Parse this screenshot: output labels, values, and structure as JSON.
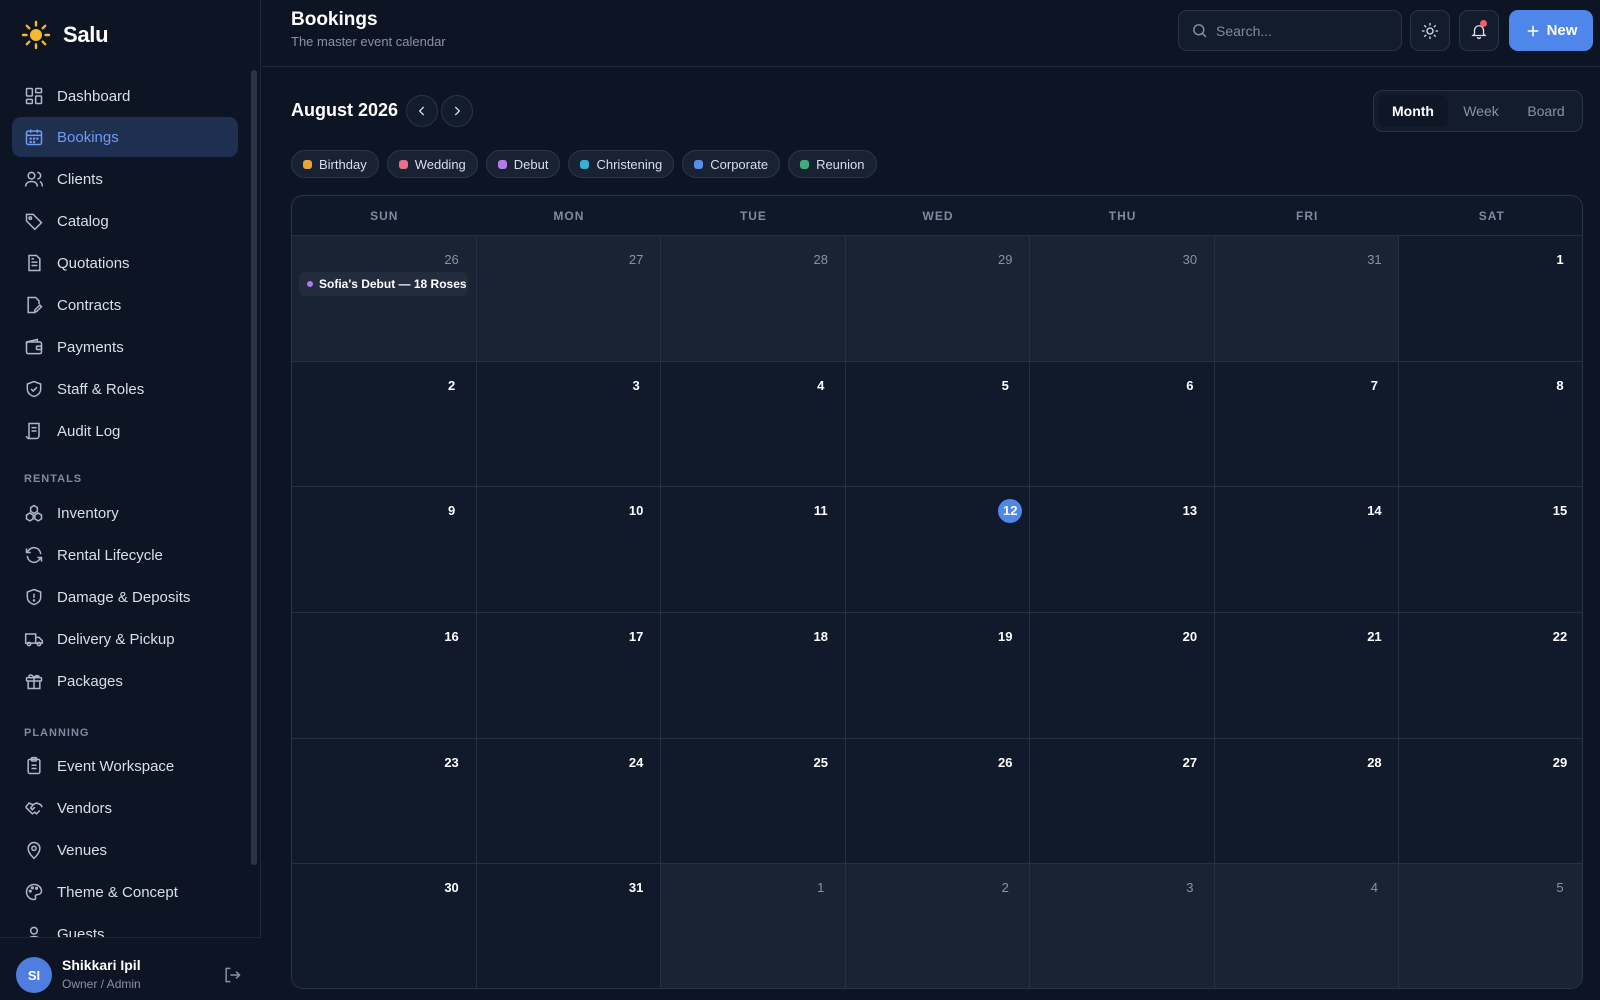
{
  "brand": {
    "name": "Salu"
  },
  "sidebar": {
    "items": [
      {
        "label": "Dashboard",
        "icon": "dashboard-icon",
        "active": false
      },
      {
        "label": "Bookings",
        "icon": "calendar-icon",
        "active": true
      },
      {
        "label": "Clients",
        "icon": "users-icon",
        "active": false
      },
      {
        "label": "Catalog",
        "icon": "tag-icon",
        "active": false
      },
      {
        "label": "Quotations",
        "icon": "document-icon",
        "active": false
      },
      {
        "label": "Contracts",
        "icon": "contract-icon",
        "active": false
      },
      {
        "label": "Payments",
        "icon": "wallet-icon",
        "active": false
      },
      {
        "label": "Staff & Roles",
        "icon": "shield-check-icon",
        "active": false
      },
      {
        "label": "Audit Log",
        "icon": "log-icon",
        "active": false
      }
    ],
    "rentals_heading": "RENTALS",
    "rentals": [
      {
        "label": "Inventory",
        "icon": "boxes-icon"
      },
      {
        "label": "Rental Lifecycle",
        "icon": "refresh-icon"
      },
      {
        "label": "Damage & Deposits",
        "icon": "shield-alert-icon"
      },
      {
        "label": "Delivery & Pickup",
        "icon": "truck-icon"
      },
      {
        "label": "Packages",
        "icon": "gift-icon"
      }
    ],
    "planning_heading": "PLANNING",
    "planning": [
      {
        "label": "Event Workspace",
        "icon": "clipboard-icon"
      },
      {
        "label": "Vendors",
        "icon": "handshake-icon"
      },
      {
        "label": "Venues",
        "icon": "map-pin-icon"
      },
      {
        "label": "Theme & Concept",
        "icon": "palette-icon"
      },
      {
        "label": "Guests",
        "icon": "user-icon"
      }
    ]
  },
  "user": {
    "initials": "SI",
    "name": "Shikkari Ipil",
    "role": "Owner / Admin"
  },
  "header": {
    "title": "Bookings",
    "subtitle": "The master event calendar",
    "search_placeholder": "Search...",
    "new_label": "New"
  },
  "calendar": {
    "month_label": "August 2026",
    "views": [
      "Month",
      "Week",
      "Board"
    ],
    "active_view": "Month",
    "legend": [
      {
        "label": "Birthday",
        "color": "#e6a53a"
      },
      {
        "label": "Wedding",
        "color": "#e8708a"
      },
      {
        "label": "Debut",
        "color": "#b07ce8"
      },
      {
        "label": "Christening",
        "color": "#3aaed8"
      },
      {
        "label": "Corporate",
        "color": "#5b8de6"
      },
      {
        "label": "Reunion",
        "color": "#3fae7a"
      }
    ],
    "weekdays": [
      "SUN",
      "MON",
      "TUE",
      "WED",
      "THU",
      "FRI",
      "SAT"
    ],
    "days": [
      {
        "n": "26",
        "other": true
      },
      {
        "n": "27",
        "other": true
      },
      {
        "n": "28",
        "other": true
      },
      {
        "n": "29",
        "other": true
      },
      {
        "n": "30",
        "other": true
      },
      {
        "n": "31",
        "other": true
      },
      {
        "n": "1",
        "other": false
      },
      {
        "n": "2",
        "other": false
      },
      {
        "n": "3",
        "other": false
      },
      {
        "n": "4",
        "other": false
      },
      {
        "n": "5",
        "other": false
      },
      {
        "n": "6",
        "other": false
      },
      {
        "n": "7",
        "other": false
      },
      {
        "n": "8",
        "other": false
      },
      {
        "n": "9",
        "other": false
      },
      {
        "n": "10",
        "other": false
      },
      {
        "n": "11",
        "other": false
      },
      {
        "n": "12",
        "other": false,
        "today": true
      },
      {
        "n": "13",
        "other": false
      },
      {
        "n": "14",
        "other": false
      },
      {
        "n": "15",
        "other": false
      },
      {
        "n": "16",
        "other": false
      },
      {
        "n": "17",
        "other": false
      },
      {
        "n": "18",
        "other": false
      },
      {
        "n": "19",
        "other": false
      },
      {
        "n": "20",
        "other": false
      },
      {
        "n": "21",
        "other": false
      },
      {
        "n": "22",
        "other": false
      },
      {
        "n": "23",
        "other": false
      },
      {
        "n": "24",
        "other": false
      },
      {
        "n": "25",
        "other": false
      },
      {
        "n": "26",
        "other": false
      },
      {
        "n": "27",
        "other": false
      },
      {
        "n": "28",
        "other": false
      },
      {
        "n": "29",
        "other": false
      },
      {
        "n": "30",
        "other": false
      },
      {
        "n": "31",
        "other": false
      },
      {
        "n": "1",
        "other": true
      },
      {
        "n": "2",
        "other": true
      },
      {
        "n": "3",
        "other": true
      },
      {
        "n": "4",
        "other": true
      },
      {
        "n": "5",
        "other": true
      }
    ],
    "events": [
      {
        "day_index": 0,
        "title": "Sofia's Debut — 18 Roses",
        "type": "Debut"
      }
    ]
  }
}
